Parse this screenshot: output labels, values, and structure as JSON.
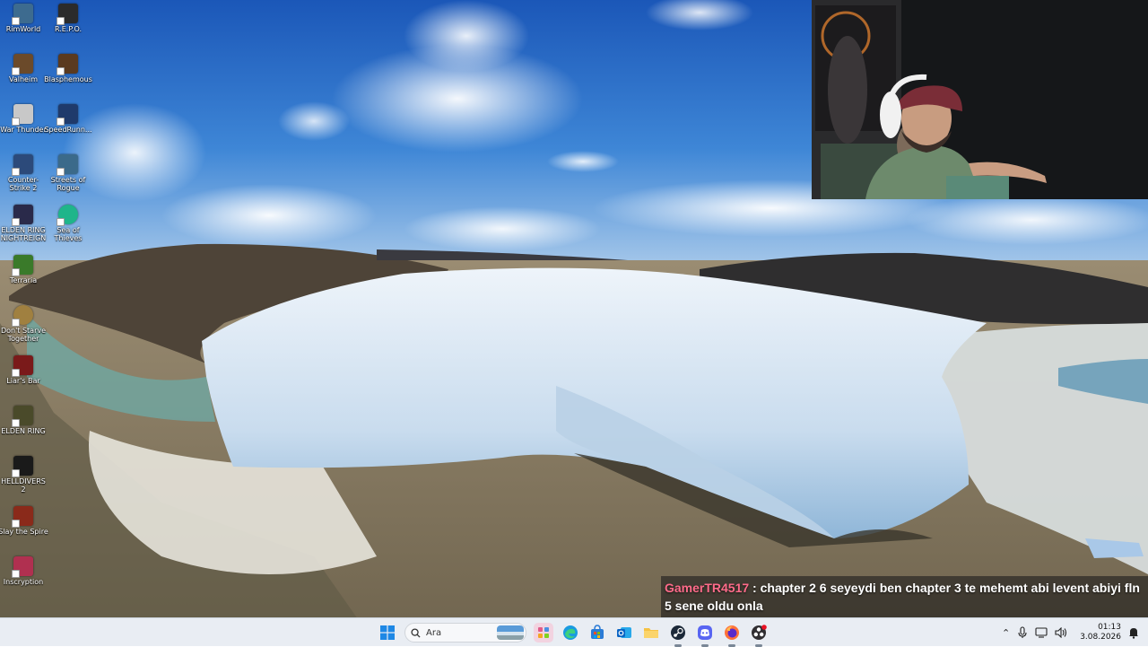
{
  "desktop": {
    "icons": [
      {
        "label": "RimWorld",
        "color": "#3d6b8f"
      },
      {
        "label": "R.E.P.O.",
        "color": "#2b2b2b"
      },
      {
        "label": "Valheim",
        "color": "#6b4a2a"
      },
      {
        "label": "Blasphemous",
        "color": "#5a3a1f"
      },
      {
        "label": "War Thunder",
        "color": "#c8c8c8"
      },
      {
        "label": "SpeedRunn...",
        "color": "#1f3a6b"
      },
      {
        "label": "Counter-Strike 2",
        "color": "#2c4a7a"
      },
      {
        "label": "Streets of Rogue",
        "color": "#3b6a8a"
      },
      {
        "label": "ELDEN RING NIGHTREIGN",
        "color": "#2a2a4a"
      },
      {
        "label": "Sea of Thieves",
        "color": "#1fb58a"
      },
      {
        "label": "Terraria",
        "color": "#3a7a2a"
      },
      {
        "label": "Don't Starve Together",
        "color": "#a08040"
      },
      {
        "label": "Liar's Bar",
        "color": "#7a1a1a"
      },
      {
        "label": "ELDEN RING",
        "color": "#4a4a2a"
      },
      {
        "label": "HELLDIVERS 2",
        "color": "#1a1a1a"
      },
      {
        "label": "Slay the Spire",
        "color": "#8a2a1a"
      },
      {
        "label": "Inscryption",
        "color": "#b03050"
      }
    ]
  },
  "chat": {
    "username": "GamerTR4517",
    "separator": " : ",
    "message": "chapter 2 6 seyeydi ben chapter 3 te mehemt abi levent abiyi fln 5 sene oldu onla"
  },
  "taskbar": {
    "search_placeholder": "Ara",
    "apps": [
      "widgets",
      "microsoft-edge",
      "microsoft-store",
      "outlook",
      "file-explorer",
      "steam",
      "discord",
      "firefox",
      "obs-studio"
    ],
    "clock_time": "01:13",
    "clock_date": "3.08.2026"
  }
}
